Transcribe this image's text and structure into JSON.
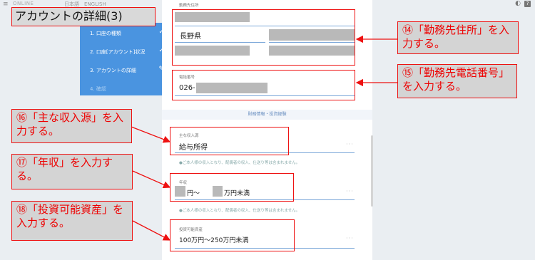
{
  "title": "アカウントの詳細(3)",
  "topbar": {
    "menu_icon": "≡",
    "brand": "ONLINE",
    "lang": "日本語　ENGLISH",
    "contrast_icon": "◐",
    "help_icon": "?"
  },
  "steps": [
    {
      "label": "1. 口座の種類",
      "mark": "✓"
    },
    {
      "label": "2. 口座[アカウント]状況",
      "mark": "✓"
    },
    {
      "label": "3. アカウントの詳細",
      "mark": "✎"
    },
    {
      "label": "4. 確認",
      "mark": ""
    }
  ],
  "form": {
    "work_address_caption": "勤務先住所",
    "prefecture": "長野県",
    "work_phone_caption": "電話番号",
    "work_phone_prefix": "026-",
    "section_header": "財務情報・投資経験",
    "income_source_caption": "主な収入源",
    "income_source_value": "給与所得",
    "income_source_note": "●ご本人様の収入となり、配偶者の収入、仕送り等は含まれません。",
    "annual_income_caption": "年収",
    "annual_income_mid": "円～",
    "annual_income_suffix": "万円未満",
    "annual_income_note": "●ご本人様の収入となり、配偶者の収入、仕送り等は含まれません。",
    "assets_caption": "投資可能資産",
    "assets_value": "100万円～250万円未満",
    "more_dots": "···"
  },
  "callouts": {
    "c14": "⑭「勤務先住所」を入力する。",
    "c15": "⑮「勤務先電話番号」を入力する。",
    "c16": "⑯「主な収入源」を入力する。",
    "c17": "⑰「年収」を入力する。",
    "c18": "⑱「投資可能資産」を入力する。"
  },
  "colors": {
    "accent": "#4a94e0",
    "annotation": "#ee1111"
  }
}
